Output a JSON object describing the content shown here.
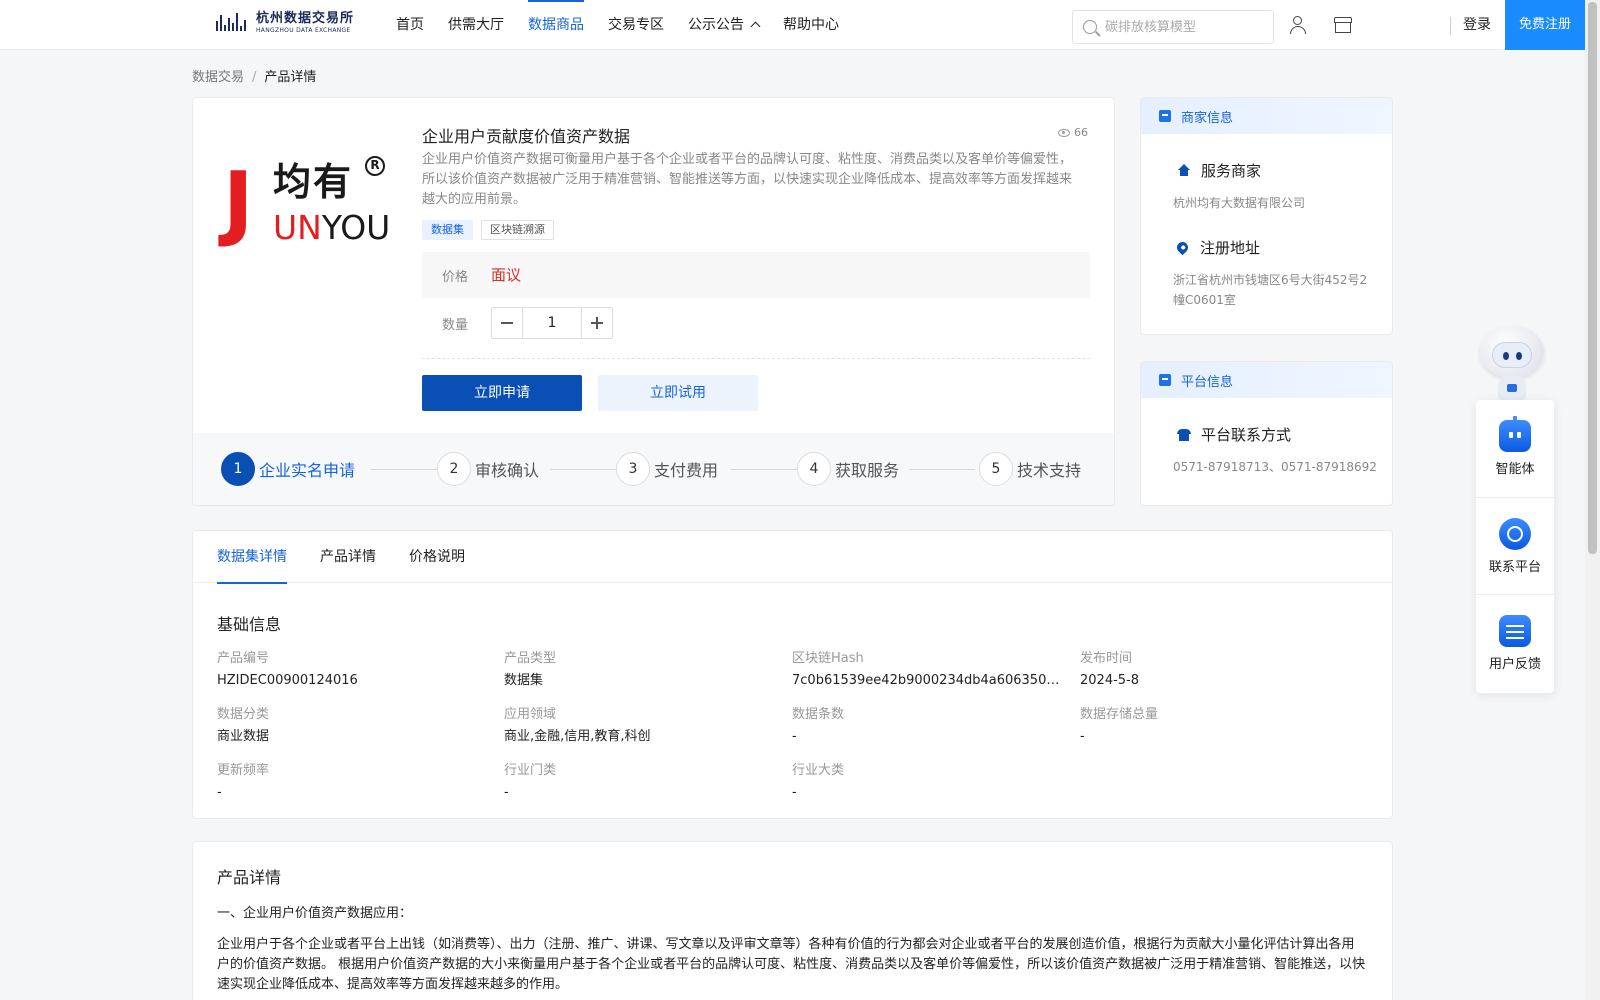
{
  "header": {
    "logo_cn": "杭州数据交易所",
    "logo_en": "HANGZHOU DATA EXCHANGE",
    "nav": [
      {
        "label": "首页"
      },
      {
        "label": "供需大厅"
      },
      {
        "label": "数据商品",
        "active": true
      },
      {
        "label": "交易专区"
      },
      {
        "label": "公示公告"
      },
      {
        "label": "帮助中心"
      }
    ],
    "search_placeholder": "碳排放核算模型",
    "login": "登录",
    "register": "免费注册"
  },
  "breadcrumb": {
    "root": "数据交易",
    "sep": "/",
    "current": "产品详情"
  },
  "product": {
    "brand_logo": {
      "cn": "均有",
      "letter": "J",
      "en_red": "UN",
      "en_dark": "YOU",
      "reg": "R"
    },
    "title": "企业用户贡献度价值资产数据",
    "views": "66",
    "description": "企业用户价值资产数据可衡量用户基于各个企业或者平台的品牌认可度、粘性度、消费品类以及客单价等偏爱性，所以该价值资产数据被广泛用于精准营销、智能推送等方面，以快速实现企业降低成本、提高效率等方面发挥越来越大的应用前景。",
    "tags": [
      "数据集",
      "区块链溯源"
    ],
    "price_label": "价格",
    "price_value": "面议",
    "qty_label": "数量",
    "qty_value": "1",
    "apply_label": "立即申请",
    "trial_label": "立即试用"
  },
  "steps": [
    {
      "num": "1",
      "label": "企业实名申请",
      "active": true
    },
    {
      "num": "2",
      "label": "审核确认"
    },
    {
      "num": "3",
      "label": "支付费用"
    },
    {
      "num": "4",
      "label": "获取服务"
    },
    {
      "num": "5",
      "label": "技术支持"
    }
  ],
  "merchant": {
    "header": "商家信息",
    "service_label": "服务商家",
    "service_value": "杭州均有大数据有限公司",
    "address_label": "注册地址",
    "address_value": "浙江省杭州市钱塘区6号大街452号2幢C0601室"
  },
  "platform": {
    "header": "平台信息",
    "contact_label": "平台联系方式",
    "contact_value": "0571-87918713、0571-87918692"
  },
  "float_menu": [
    {
      "label": "智能体",
      "icon": "ai-agent-icon"
    },
    {
      "label": "联系平台",
      "icon": "headset-icon"
    },
    {
      "label": "用户反馈",
      "icon": "feedback-icon"
    }
  ],
  "tabs": [
    "数据集详情",
    "产品详情",
    "价格说明"
  ],
  "basic_info": {
    "title": "基础信息",
    "fields": [
      {
        "label": "产品编号",
        "value": "HZIDEC00900124016"
      },
      {
        "label": "产品类型",
        "value": "数据集"
      },
      {
        "label": "区块链Hash",
        "value": "7c0b61539ee42b9000234db4a606350a9f..."
      },
      {
        "label": "发布时间",
        "value": "2024-5-8"
      },
      {
        "label": "数据分类",
        "value": "商业数据"
      },
      {
        "label": "应用领域",
        "value": "商业,金融,信用,教育,科创"
      },
      {
        "label": "数据条数",
        "value": "-"
      },
      {
        "label": "数据存储总量",
        "value": "-"
      },
      {
        "label": "更新频率",
        "value": "-"
      },
      {
        "label": "行业门类",
        "value": "-"
      },
      {
        "label": "行业大类",
        "value": "-"
      }
    ]
  },
  "product_detail": {
    "title": "产品详情",
    "subtitle": "一、企业用户价值资产数据应用：",
    "body": "企业用户于各个企业或者平台上出钱（如消费等）、出力（注册、推广、讲课、写文章以及评审文章等）各种有价值的行为都会对企业或者平台的发展创造价值，根据行为贡献大小量化评估计算出各用户的价值资产数据。 根据用户价值资产数据的大小来衡量用户基于各个企业或者平台的品牌认可度、粘性度、消费品类以及客单价等偏爱性，所以该价值资产数据被广泛用于精准营销、智能推送，以快速实现企业降低成本、提高效率等方面发挥越来越多的作用。"
  }
}
